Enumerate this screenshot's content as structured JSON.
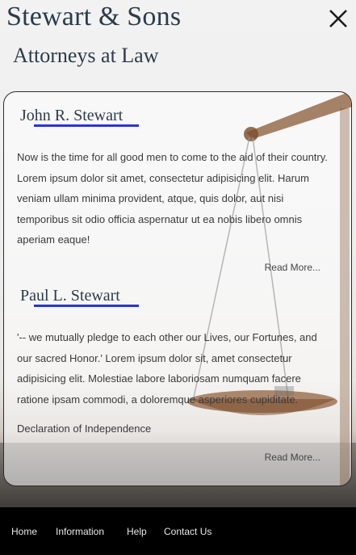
{
  "header": {
    "title": "Stewart & Sons",
    "subtitle": "Attorneys at Law",
    "close_icon": "close-icon"
  },
  "articles": [
    {
      "name": "John R. Stewart",
      "body": "Now is the time for all good men to come to the aid of their country. Lorem ipsum dolor sit amet, consectetur adipisicing elit. Harum veniam ullam minima provident, atque, quis dolor, aut nisi temporibus sit odio officia aspernatur ut ea nobis libero omnis aperiam eaque!",
      "read_more": "Read More..."
    },
    {
      "name": "Paul L. Stewart",
      "body": "'-- we mutually pledge to each other our Lives, our Fortunes, and our sacred Honor.' Lorem ipsum dolor sit, amet consectetur adipisicing elit. Molestiae labore laboriosam numquam facere ratione ipsam commodi, a doloremque asperiores cupiditate.",
      "source": "Declaration of Independence",
      "read_more": "Read More..."
    }
  ],
  "footer": {
    "links": [
      "Home",
      "Information",
      "Help",
      "Contact Us"
    ]
  },
  "colors": {
    "heading": "#2d3b4a",
    "accent_underline": "#2a34d8",
    "footer_bg": "#000000"
  }
}
